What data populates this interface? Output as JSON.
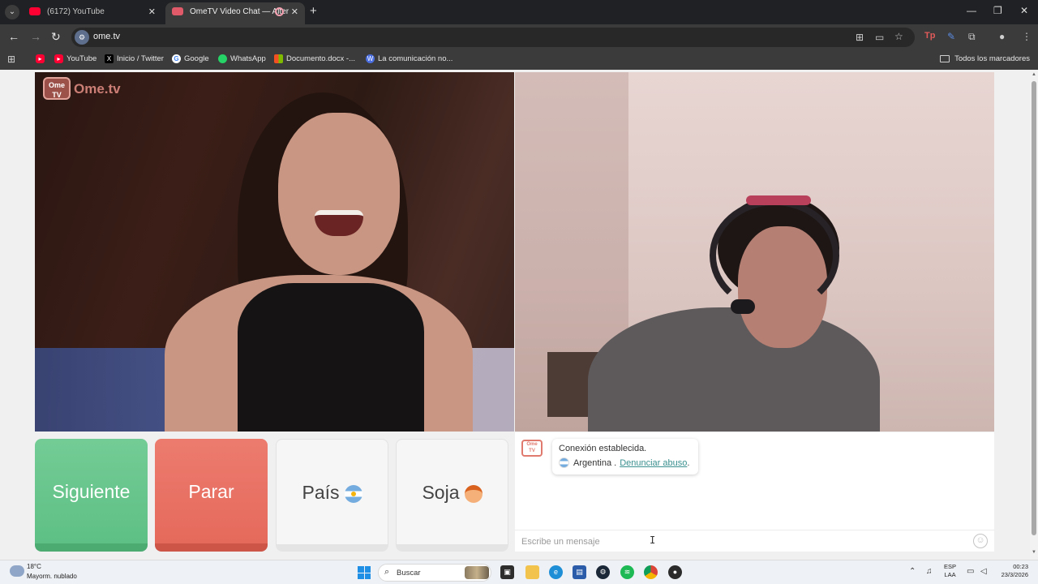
{
  "browser": {
    "tabs": [
      {
        "title": "(6172) YouTube",
        "active": false
      },
      {
        "title": "OmeTV Video Chat — Alter",
        "active": true
      }
    ],
    "url": "ome.tv",
    "bookmarks": [
      {
        "label": ""
      },
      {
        "label": "YouTube"
      },
      {
        "label": "Inicio / Twitter"
      },
      {
        "label": "Google"
      },
      {
        "label": "WhatsApp"
      },
      {
        "label": "Documento.docx -..."
      },
      {
        "label": "La comunicación no..."
      }
    ],
    "all_bookmarks": "Todos los marcadores"
  },
  "site": {
    "logo_badge": "Ome TV",
    "logo_text": "Ome.tv"
  },
  "controls": {
    "next": "Siguiente",
    "stop": "Parar",
    "country": "País",
    "gender": "Soja"
  },
  "chat": {
    "status": "Conexión establecida.",
    "country": "Argentina .",
    "report": "Denunciar abuso",
    "report_suffix": ".",
    "placeholder": "Escribe un mensaje"
  },
  "taskbar": {
    "temperature": "18°C",
    "weather": "Mayorm. nublado",
    "search": "Buscar",
    "lang_top": "ESP",
    "lang_bottom": "LAA",
    "time": "00:23",
    "date": "23/3/2026"
  },
  "colors": {
    "next": "#5ec085",
    "stop": "#e56a5c",
    "accent_link": "#3a8f8f"
  }
}
